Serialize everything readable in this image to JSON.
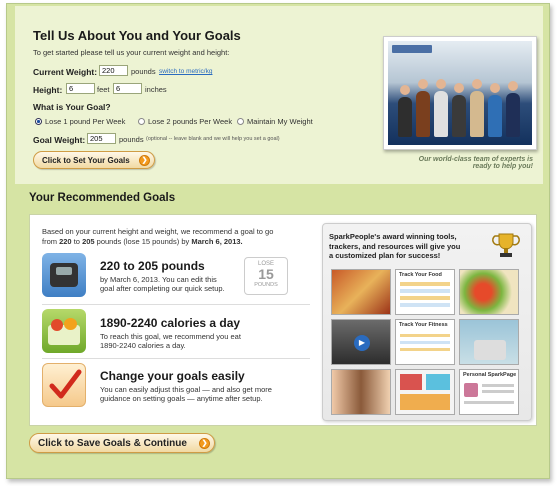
{
  "about": {
    "title": "Tell Us About You and Your Goals",
    "intro": "To get started please tell us your current weight and height:",
    "current_weight_label": "Current Weight:",
    "current_weight_value": "220",
    "pounds_unit": "pounds",
    "metric_link": "switch to metric/kg",
    "height_label": "Height:",
    "height_feet_value": "6",
    "feet_unit": "feet",
    "height_inches_value": "6",
    "inches_unit": "inches",
    "goal_question": "What is Your Goal?",
    "goal_options": [
      "Lose 1 pound Per Week",
      "Lose 2 pounds Per Week",
      "Maintain My Weight"
    ],
    "selected_goal": "Lose 1 pound Per Week",
    "goal_weight_label": "Goal Weight:",
    "goal_weight_value": "205",
    "goal_weight_unit": "pounds",
    "goal_weight_note": "(optional -- leave blank and we will help you set a goal)",
    "set_goals_button": "Click to Set Your Goals"
  },
  "photo": {
    "caption_line1": "Our world-class team of experts is",
    "caption_line2": "ready to help you!"
  },
  "recommended": {
    "title": "Your Recommended Goals",
    "summary_line1": "Based on your current height and weight, we recommend a goal to go",
    "summary_line2_prefix": "from",
    "summary_from": "220",
    "summary_to_word": "to",
    "summary_to": "205",
    "summary_middle": "pounds (lose 15 pounds) by",
    "summary_date": "March 6, 2013.",
    "goals": [
      {
        "title": "220 to 205 pounds",
        "desc1": "by March 6, 2013. You can edit this",
        "desc2": "goal after completing our quick setup."
      },
      {
        "title": "1890-2240 calories a day",
        "desc1": "To reach this goal, we recommend you eat",
        "desc2": "1890-2240 calories a day."
      },
      {
        "title": "Change your goals easily",
        "desc1": "You can easily adjust this goal — and also get more",
        "desc2": "guidance on setting goals — anytime after setup."
      }
    ],
    "lose_badge": {
      "top": "LOSE",
      "number": "15",
      "bottom": "POUNDS"
    }
  },
  "promo": {
    "line1": "SparkPeople's award winning tools,",
    "line2": "trackers, and resources will give you",
    "line3": "a customized plan for success!",
    "thumb_labels": [
      "Track Your Food",
      "Track Your Fitness",
      "Personal SparkPage"
    ]
  },
  "save_button": "Click to Save Goals & Continue",
  "colors": {
    "accent_orange": "#f39a1e",
    "panel_green": "#d6e4a4",
    "link_blue": "#2a6bbf"
  }
}
